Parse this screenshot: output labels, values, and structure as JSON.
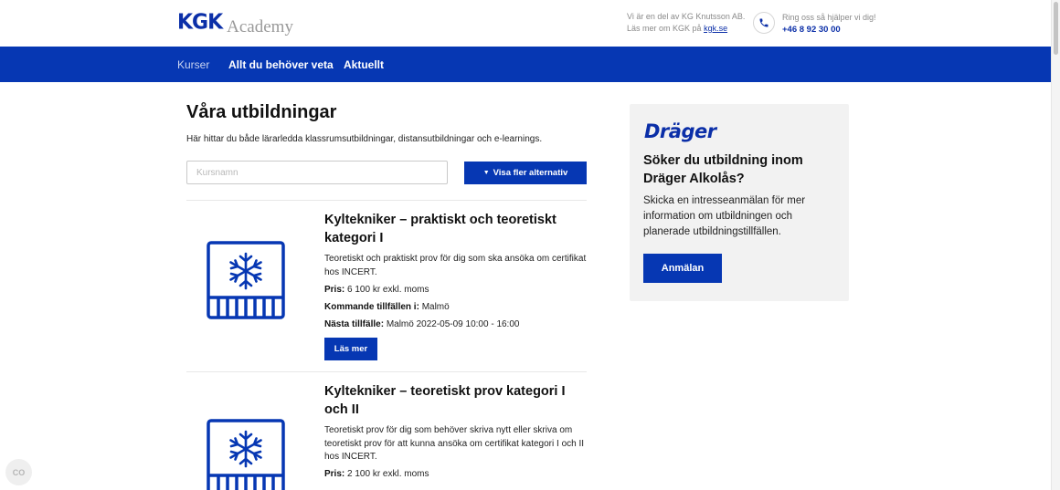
{
  "header": {
    "logo_brand": "KGK",
    "logo_suffix": "Academy",
    "about_line1": "Vi är en del av KG Knutsson AB.",
    "about_line2_prefix": "Läs mer om KGK på",
    "about_link": "kgk.se",
    "help_text": "Ring oss så hjälper vi dig!",
    "phone_number": "+46 8 92 30 00",
    "phone_icon": "phone-icon"
  },
  "nav": {
    "items": [
      {
        "label": "Kurser",
        "active": true
      },
      {
        "label": "Allt du behöver veta",
        "active": false
      },
      {
        "label": "Aktuellt",
        "active": false
      }
    ]
  },
  "main": {
    "title": "Våra utbildningar",
    "intro": "Här hittar du både lärarledda klassrumsutbildningar, distansutbildningar och e-learnings.",
    "search_placeholder": "Kursnamn",
    "search_value": "",
    "more_options_label": "Visa fler alternativ",
    "more_options_icon": "caret-down-icon"
  },
  "courses": [
    {
      "icon": "freezer-snowflake-icon",
      "title": "Kyltekniker – praktiskt och teoretiskt kategori I",
      "description": "Teoretiskt och praktiskt prov för dig som ska ansöka om certifikat hos INCERT.",
      "price_label": "Pris:",
      "price_value": "6 100 kr exkl. moms",
      "upcoming_label": "Kommande tillfällen i:",
      "upcoming_value": "Malmö",
      "next_label": "Nästa tillfälle:",
      "next_value": "Malmö 2022-05-09 10:00 - 16:00",
      "button_label": "Läs mer"
    },
    {
      "icon": "freezer-snowflake-icon",
      "title": "Kyltekniker – teoretiskt prov kategori I och II",
      "description": "Teoretiskt prov för dig som behöver skriva nytt eller skriva om teoretiskt prov för att kunna ansöka om certifikat kategori I och II hos INCERT.",
      "price_label": "Pris:",
      "price_value": "2 100 kr exkl. moms"
    }
  ],
  "sidebar": {
    "brand_logo": "Dräger",
    "title": "Söker du utbildning inom Dräger Alkolås?",
    "text": "Skicka en intresseanmälan för mer information om utbildningen och planerade utbildningstillfällen.",
    "button_label": "Anmälan"
  },
  "widget": {
    "label": "CO"
  },
  "colors": {
    "brand_blue": "#0637b3",
    "logo_blue": "#0b2fa8",
    "card_background": "#f2f2f2"
  }
}
